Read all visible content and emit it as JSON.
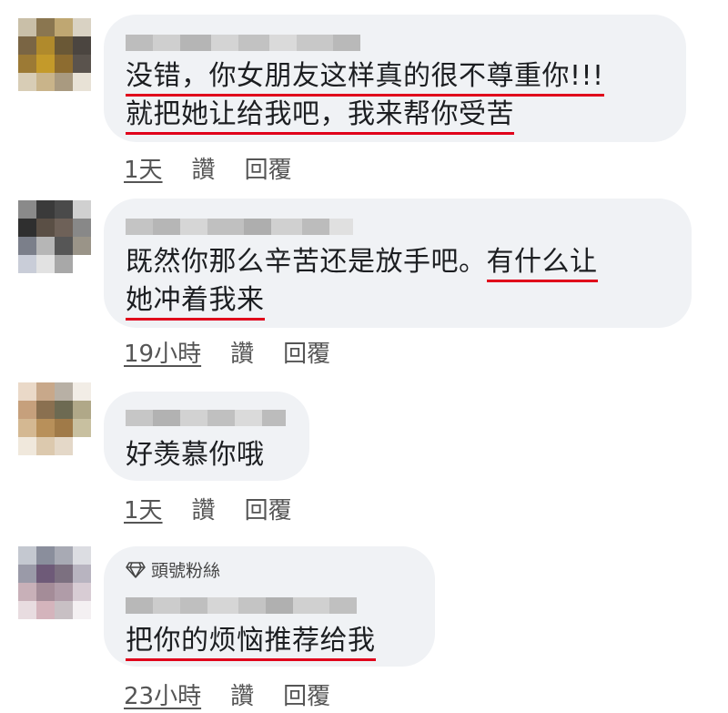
{
  "comments": [
    {
      "lines": [
        [
          {
            "t": "没错，你女朋友这样真的很不尊重你!!!",
            "u": true
          }
        ],
        [
          {
            "t": "就把她让给我吧，我来帮你受苦",
            "u": true
          }
        ]
      ],
      "time": "1天",
      "like": "讚",
      "reply": "回覆"
    },
    {
      "lines": [
        [
          {
            "t": "既然你那么辛苦还是放手吧。",
            "u": false
          },
          {
            "t": "有什么让",
            "u": true
          }
        ],
        [
          {
            "t": "她冲着我来",
            "u": true
          }
        ]
      ],
      "time": "19小時",
      "like": "讚",
      "reply": "回覆"
    },
    {
      "lines": [
        [
          {
            "t": "好羡慕你哦",
            "u": false
          }
        ]
      ],
      "time": "1天",
      "like": "讚",
      "reply": "回覆"
    },
    {
      "badge": {
        "icon": "diamond-icon",
        "label": "頭號粉絲"
      },
      "lines": [
        [
          {
            "t": "把你的烦恼推荐给我",
            "u": true
          }
        ]
      ],
      "time": "23小時",
      "like": "讚",
      "reply": "回覆"
    }
  ],
  "colors": {
    "bubble": "#f0f2f5",
    "underline": "#e0001b",
    "meta": "#555555"
  }
}
